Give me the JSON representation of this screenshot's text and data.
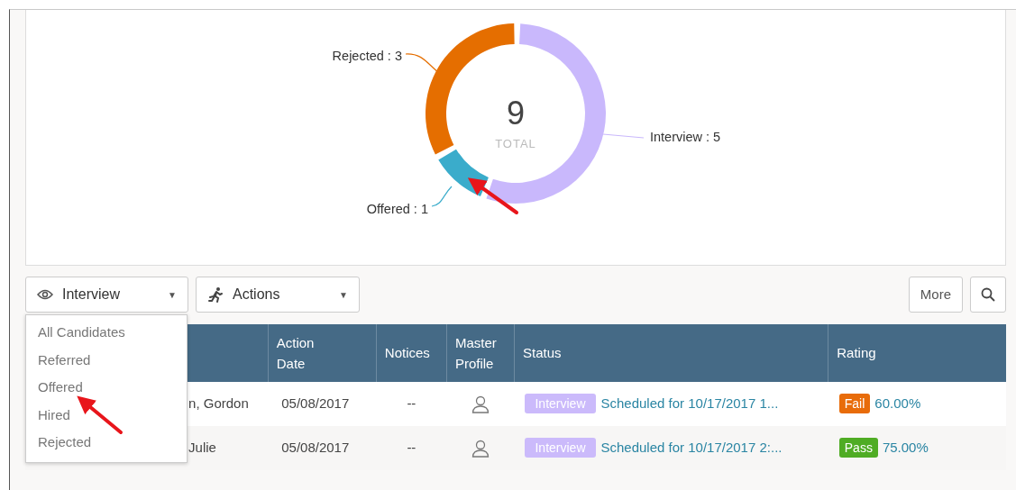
{
  "chart": {
    "total": "9",
    "total_label": "TOTAL",
    "chart_data": {
      "type": "donut",
      "categories": [
        "Interview : 5",
        "Offered : 1",
        "Rejected : 3"
      ],
      "colors": [
        "#c9b8fc",
        "#3aaccb",
        "#e56e00"
      ],
      "values": [
        5,
        1,
        3
      ]
    }
  },
  "toolbar": {
    "filter_button": "Interview",
    "actions_button": "Actions",
    "more_button": "More",
    "caret": "▼"
  },
  "filter_menu": {
    "items": [
      "All Candidates",
      "Referred",
      "Offered",
      "Hired",
      "Rejected"
    ]
  },
  "table": {
    "columns": [
      "",
      "",
      "Action Date",
      "Notices",
      "Master Profile",
      "Status",
      "Rating"
    ],
    "rows": [
      {
        "name": "n, Gordon",
        "action_date": "05/08/2017",
        "notices": "--",
        "status_badge": "Interview",
        "status": "Scheduled for 10/17/2017 1...",
        "result": "Fail",
        "color": "#e86c0a",
        "rating": "60.00%"
      },
      {
        "name": "Julie",
        "action_date": "05/08/2017",
        "notices": "--",
        "status_badge": "Interview",
        "status": "Scheduled for 10/17/2017 2:...",
        "result": "Pass",
        "color": "#4fac24",
        "rating": "75.00%"
      }
    ]
  }
}
